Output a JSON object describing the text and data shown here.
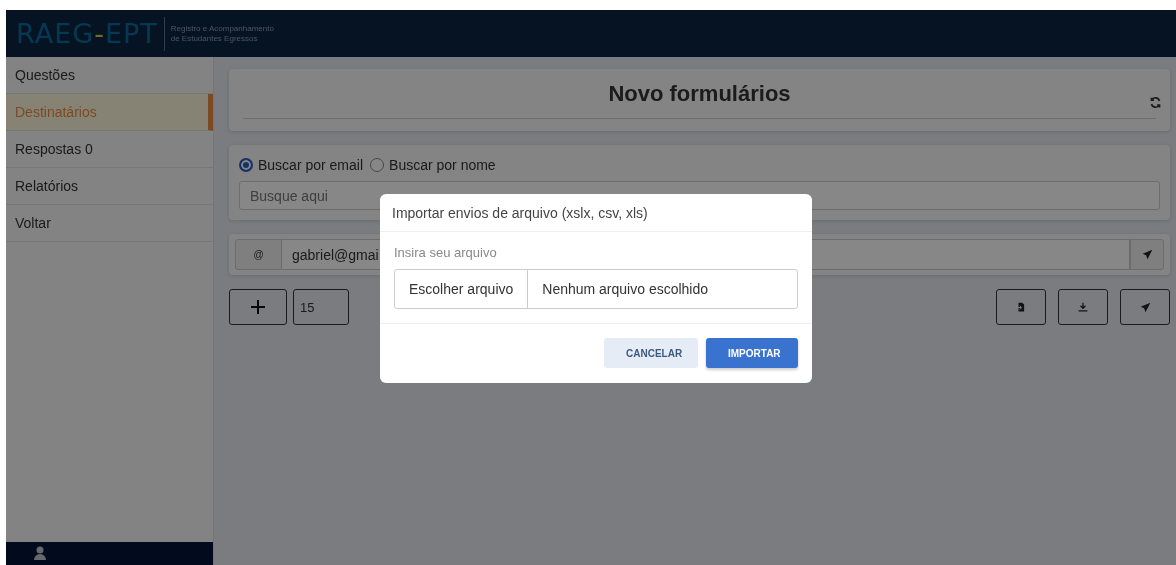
{
  "header": {
    "logo": [
      "RAEG",
      "-",
      "EPT"
    ],
    "subtitle": [
      "Registro e Acompanhamento",
      "de Estudantes Egressos"
    ]
  },
  "sidebar": {
    "items": [
      {
        "label": "Questões",
        "selected": false
      },
      {
        "label": "Destinatários",
        "selected": true
      },
      {
        "label": "Respostas 0",
        "selected": false
      },
      {
        "label": "Relatórios",
        "selected": false
      },
      {
        "label": "Voltar",
        "selected": false
      }
    ]
  },
  "title": "Novo formulários",
  "search": {
    "options": [
      {
        "label": "Buscar por email",
        "selected": true
      },
      {
        "label": "Buscar por nome",
        "selected": false
      }
    ],
    "placeholder": "Busque aqui"
  },
  "recipient": {
    "addon": "@",
    "value": "gabriel@gmai"
  },
  "count": "15",
  "dialog": {
    "title": "Importar envios de arquivo (xslx, csv, xls)",
    "label": "Insira seu arquivo",
    "file_button": "Escolher arquivo",
    "file_status": "Nenhum arquivo escolhido",
    "buttons": [
      {
        "label": "CANCELAR",
        "kind": "secondary"
      },
      {
        "label": "IMPORTAR",
        "kind": "primary"
      }
    ]
  }
}
